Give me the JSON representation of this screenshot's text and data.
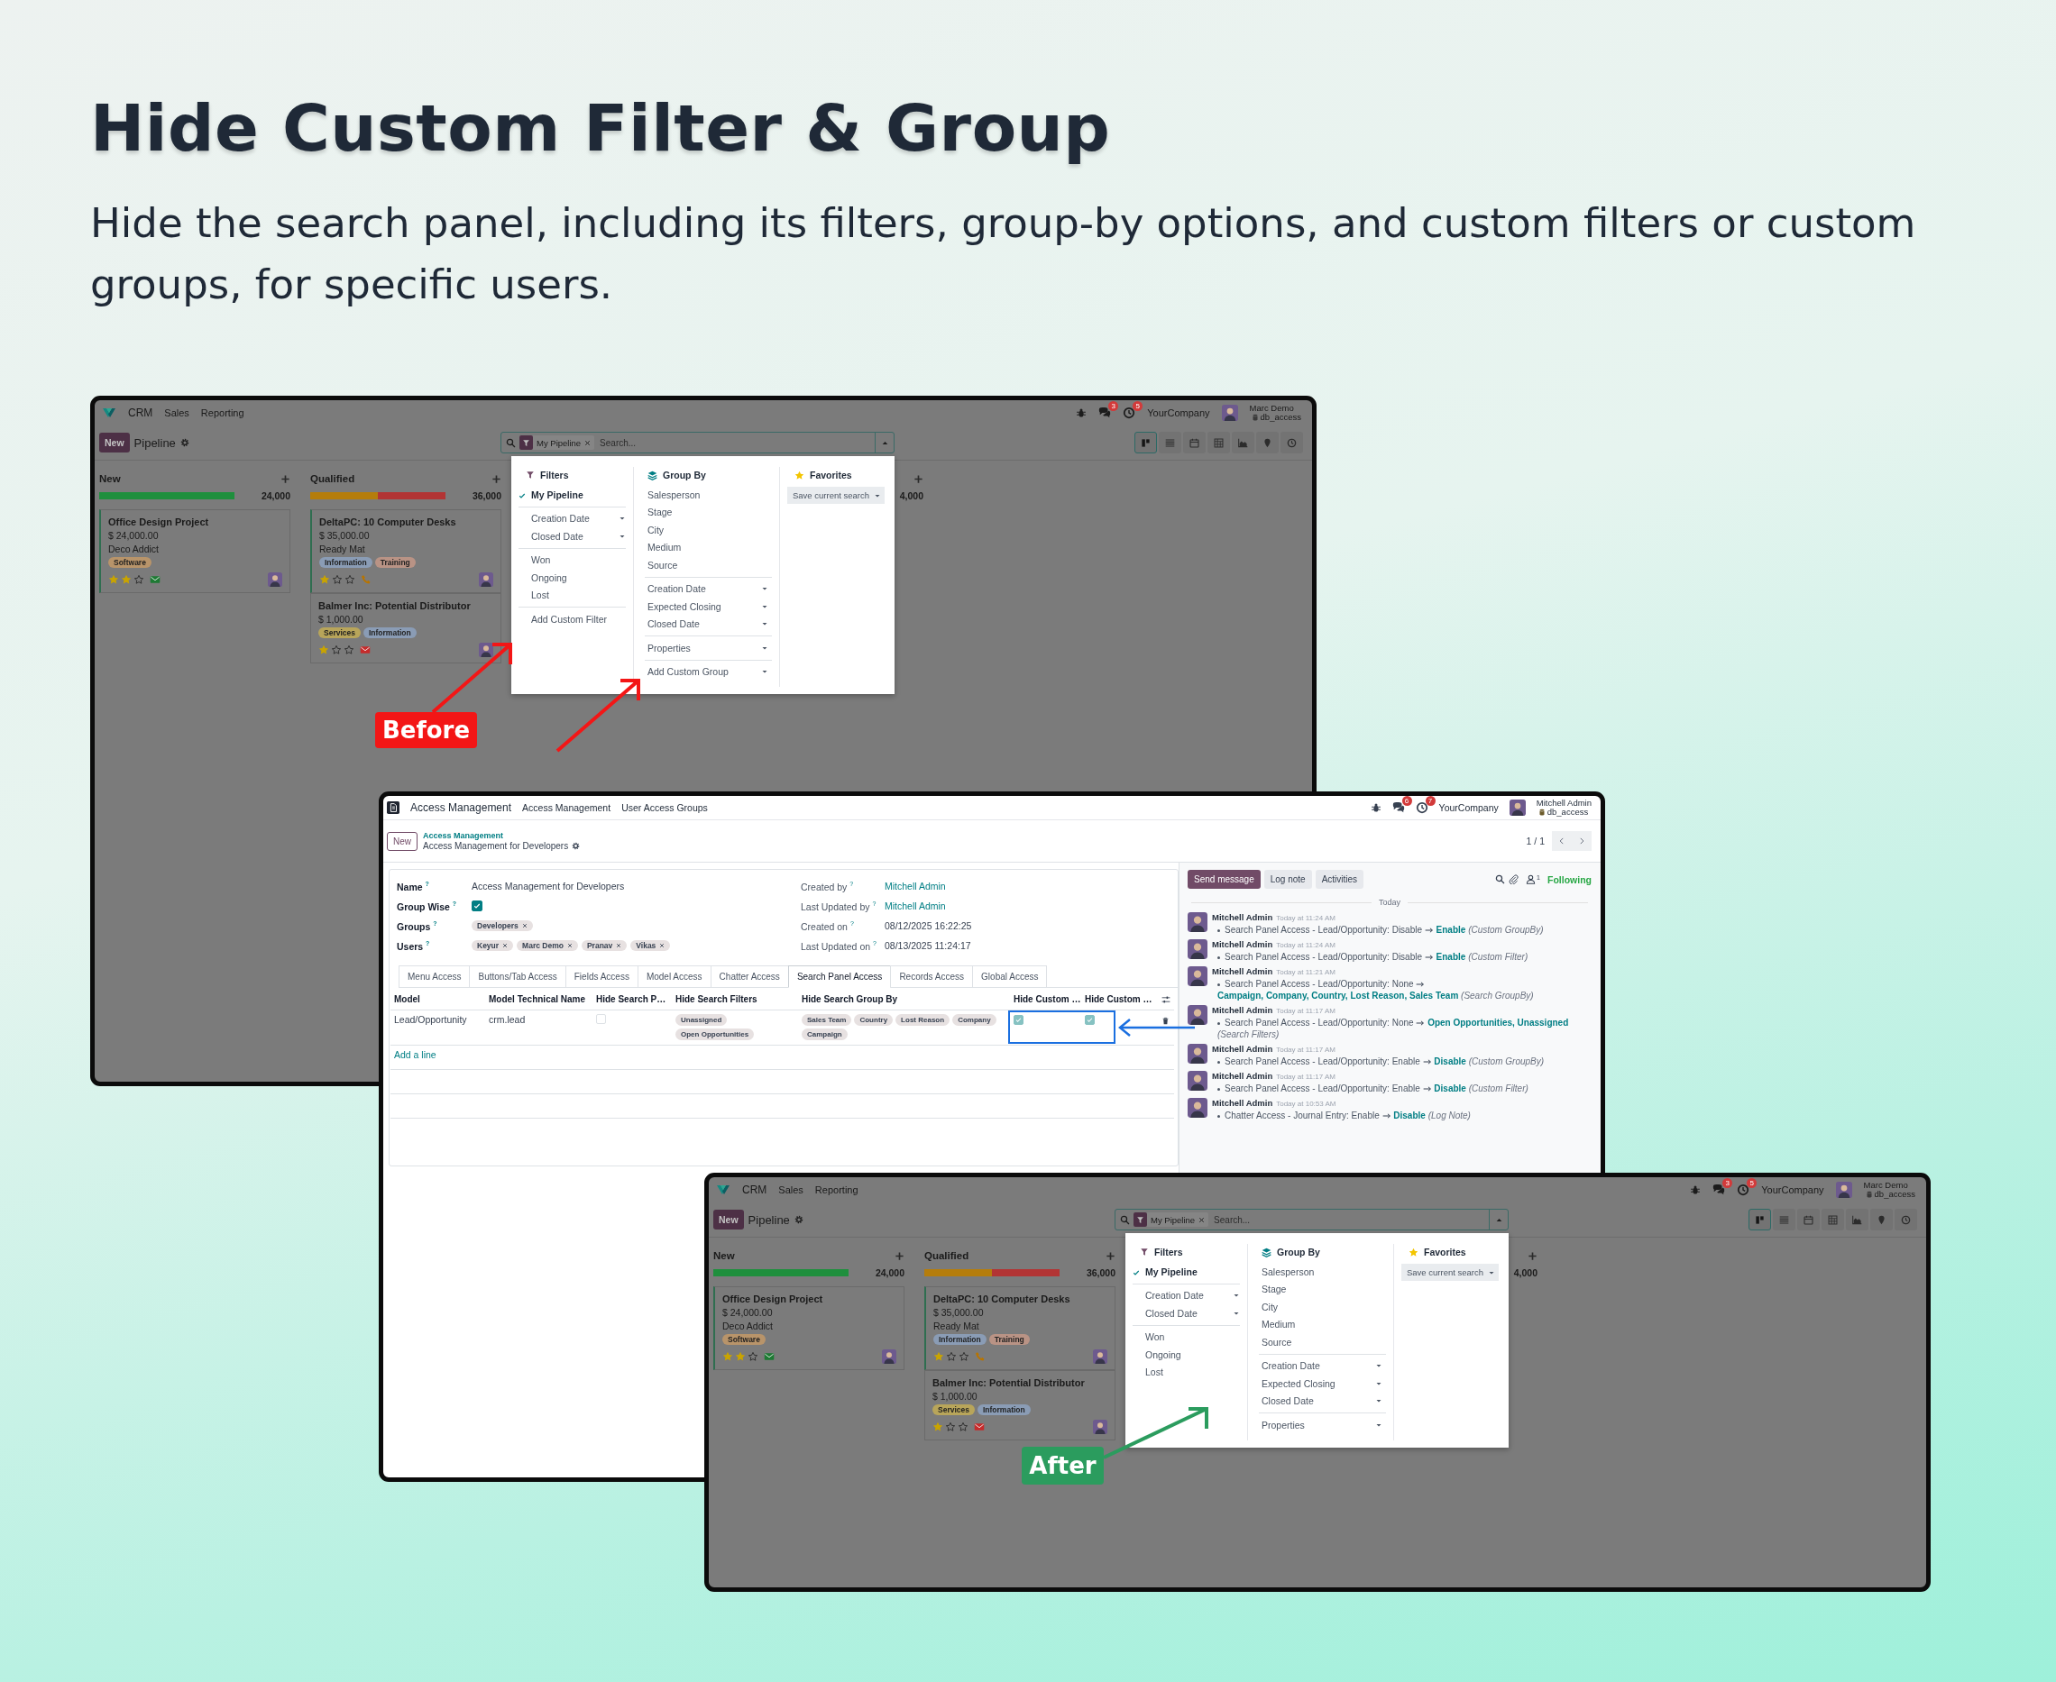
{
  "heading": {
    "title": "Hide Custom Filter & Group",
    "subtitle": "Hide the search panel, including its filters, group-by options, and custom filters or custom groups, for specific users."
  },
  "before_screen": {
    "app": "CRM",
    "menu": [
      "Sales",
      "Reporting"
    ],
    "systray": {
      "badges": [
        "3",
        "5"
      ],
      "company": "YourCompany",
      "user": "Marc Demo",
      "database": "db_access"
    },
    "new_button": "New",
    "title": "Pipeline",
    "search": {
      "facet": "My Pipeline",
      "placeholder": "Search..."
    },
    "views": [
      {
        "kind": "kanban",
        "selected": true
      },
      {
        "kind": "list",
        "selected": false
      },
      {
        "kind": "calendar",
        "selected": false
      },
      {
        "kind": "pivot",
        "selected": false
      },
      {
        "kind": "graph",
        "selected": false
      },
      {
        "kind": "map",
        "selected": false
      },
      {
        "kind": "activity",
        "selected": false
      }
    ],
    "columns": [
      {
        "title": "New",
        "total": "24,000",
        "progress": [
          {
            "color": "#1f8f3d",
            "level": 1
          }
        ],
        "cards": [
          {
            "title": "Office Design Project",
            "amount": "$ 24,000.00",
            "customer": "Deco Addict",
            "tags": [
              {
                "label": "Software",
                "color": "#b8946a"
              }
            ],
            "stars": 2,
            "activity": {
              "kind": "email",
              "color": "#1d7a33"
            }
          }
        ]
      },
      {
        "title": "Qualified",
        "total": "36,000",
        "progress": [
          {
            "color": "#b57d0c",
            "level": 0.5
          },
          {
            "color": "#b23434",
            "level": 0.5
          }
        ],
        "cards": [
          {
            "title": "DeltaPC: 10 Computer Desks",
            "amount": "$ 35,000.00",
            "customer": "Ready Mat",
            "tags": [
              {
                "label": "Information",
                "color": "#8a9cb5"
              },
              {
                "label": "Training",
                "color": "#b99385"
              }
            ],
            "stars": 1,
            "activity": {
              "kind": "phone",
              "color": "#b87400"
            }
          },
          {
            "title": "Balmer Inc: Potential Distributor",
            "amount": "$ 1,000.00",
            "tags": [
              {
                "label": "Services",
                "color": "#b8a55a"
              },
              {
                "label": "Information",
                "color": "#8a9cb5"
              }
            ],
            "stars": 1,
            "activity": {
              "kind": "email",
              "color": "#c62b2b"
            }
          }
        ]
      },
      {
        "total": "4,000"
      }
    ],
    "dropdown": {
      "filters": {
        "title": "Filters",
        "sections": [
          [
            {
              "label": "My Pipeline",
              "kind": "option",
              "checked": true
            }
          ],
          [
            {
              "label": "Creation Date",
              "kind": "submenu",
              "checked": false
            },
            {
              "label": "Closed Date",
              "kind": "submenu",
              "checked": false
            }
          ],
          [
            {
              "label": "Won",
              "kind": "option",
              "checked": false
            },
            {
              "label": "Ongoing",
              "kind": "option",
              "checked": false
            },
            {
              "label": "Lost",
              "kind": "option",
              "checked": false
            }
          ],
          [
            {
              "label": "Add Custom Filter",
              "kind": "action",
              "checked": false
            }
          ]
        ]
      },
      "group_by": {
        "title": "Group By",
        "sections": [
          [
            {
              "label": "Salesperson",
              "kind": "option"
            },
            {
              "label": "Stage",
              "kind": "option"
            },
            {
              "label": "City",
              "kind": "option"
            },
            {
              "label": "Medium",
              "kind": "option"
            },
            {
              "label": "Source",
              "kind": "option"
            }
          ],
          [
            {
              "label": "Creation Date",
              "kind": "submenu"
            },
            {
              "label": "Expected Closing",
              "kind": "submenu"
            },
            {
              "label": "Closed Date",
              "kind": "submenu"
            }
          ],
          [
            {
              "label": "Properties",
              "kind": "submenu"
            }
          ],
          [
            {
              "label": "Add Custom Group",
              "kind": "select"
            }
          ]
        ]
      },
      "favorites": {
        "title": "Favorites",
        "save_button": "Save current search"
      }
    }
  },
  "form_screen": {
    "app": "Access Management",
    "menu": [
      "Access Management",
      "User Access Groups"
    ],
    "systray": {
      "badges": [
        "6",
        "7"
      ],
      "company": "YourCompany",
      "user": "Mitchell Admin",
      "database": "db_access"
    },
    "new_button": "New",
    "breadcrumb": {
      "parent": "Access Management",
      "current": "Access Management for Developers"
    },
    "pager": "1 / 1",
    "fields_left": [
      {
        "label": "Name $^{?}$",
        "kind": "text",
        "value": "Access Management for Developers"
      },
      {
        "label": "Group Wise $^{?}$",
        "kind": "checkbox",
        "checked": true
      },
      {
        "label": "Groups $^{?}$",
        "kind": "tags",
        "tags": [
          "Developers"
        ]
      },
      {
        "label": "Users $^{?}$",
        "kind": "tags",
        "tags": [
          "Keyur",
          "Marc Demo",
          "Pranav",
          "Vikas"
        ]
      }
    ],
    "fields_right": [
      {
        "label": "Created by $^{?}$",
        "kind": "link",
        "value": "Mitchell Admin"
      },
      {
        "label": "Last Updated by $^{?}$",
        "kind": "link",
        "value": "Mitchell Admin"
      },
      {
        "label": "Created on $^{?}$",
        "kind": "text",
        "value": "08/12/2025 16:22:25"
      },
      {
        "label": "Last Updated on $^{?}$",
        "kind": "text",
        "value": "08/13/2025 11:24:17"
      }
    ],
    "tabs": [
      {
        "label": "Menu Access",
        "selected": false
      },
      {
        "label": "Buttons/Tab Access",
        "selected": false
      },
      {
        "label": "Fields Access",
        "selected": false
      },
      {
        "label": "Model Access",
        "selected": false
      },
      {
        "label": "Chatter Access",
        "selected": false
      },
      {
        "label": "Search Panel Access",
        "selected": true
      },
      {
        "label": "Records Access",
        "selected": false
      },
      {
        "label": "Global Access",
        "selected": false
      }
    ],
    "table": {
      "columns": [
        "Model",
        "Model Technical Name",
        "Hide Search P…",
        "Hide Search Filters",
        "Hide Search Group By",
        "Hide Custom …",
        "Hide Custom …"
      ],
      "rows": [
        {
          "cells": [
            {
              "kind": "text",
              "text": "Lead/Opportunity"
            },
            {
              "kind": "text",
              "text": "crm.lead"
            },
            {
              "kind": "checkbox",
              "checked": false
            },
            {
              "kind": "tags",
              "tags": [
                "Unassigned",
                "Open Opportunities"
              ]
            },
            {
              "kind": "tags",
              "tags": [
                "Sales Team",
                "Country",
                "Lost Reason",
                "Company",
                "Campaign"
              ]
            },
            {
              "kind": "checkbox",
              "checked": true
            },
            {
              "kind": "checkbox",
              "checked": true
            }
          ]
        }
      ],
      "add_line": "Add a line"
    },
    "chatter": {
      "buttons": [
        {
          "label": "Send message",
          "selected": true
        },
        {
          "label": "Log note",
          "selected": false
        },
        {
          "label": "Activities",
          "selected": false
        }
      ],
      "followers": "1",
      "following": "Following",
      "date_separator": "Today",
      "messages": [
        {
          "author": "Mitchell Admin",
          "time": "Today at 11:24 AM",
          "change": "Search Panel Access - Lead/Opportunity: Disable",
          "new_value": "Enable",
          "field": "(Custom GroupBy)"
        },
        {
          "author": "Mitchell Admin",
          "time": "Today at 11:24 AM",
          "change": "Search Panel Access - Lead/Opportunity: Disable",
          "new_value": "Enable",
          "field": "(Custom Filter)"
        },
        {
          "author": "Mitchell Admin",
          "time": "Today at 11:21 AM",
          "change": "Search Panel Access - Lead/Opportunity: None",
          "new_value": "Campaign, Company, Country, Lost Reason, Sales Team",
          "field": "(Search GroupBy)"
        },
        {
          "author": "Mitchell Admin",
          "time": "Today at 11:17 AM",
          "change": "Search Panel Access - Lead/Opportunity: None",
          "new_value": "Open Opportunities, Unassigned",
          "field": "(Search Filters)"
        },
        {
          "author": "Mitchell Admin",
          "time": "Today at 11:17 AM",
          "change": "Search Panel Access - Lead/Opportunity: Enable",
          "new_value": "Disable",
          "field": "(Custom GroupBy)"
        },
        {
          "author": "Mitchell Admin",
          "time": "Today at 11:17 AM",
          "change": "Search Panel Access - Lead/Opportunity: Enable",
          "new_value": "Disable",
          "field": "(Custom Filter)"
        },
        {
          "author": "Mitchell Admin",
          "time": "Today at 10:53 AM",
          "change": "Chatter Access - Journal Entry: Enable",
          "new_value": "Disable",
          "field": "(Log Note)"
        }
      ]
    }
  },
  "after_screen": {
    "app": "CRM",
    "menu": [
      "Sales",
      "Reporting"
    ],
    "systray": {
      "badges": [
        "3",
        "5"
      ],
      "company": "YourCompany",
      "user": "Marc Demo",
      "database": "db_access"
    },
    "new_button": "New",
    "title": "Pipeline",
    "search": {
      "facet": "My Pipeline",
      "placeholder": "Search..."
    },
    "views": [
      {
        "kind": "kanban",
        "selected": true
      },
      {
        "kind": "list",
        "selected": false
      },
      {
        "kind": "calendar",
        "selected": false
      },
      {
        "kind": "pivot",
        "selected": false
      },
      {
        "kind": "graph",
        "selected": false
      },
      {
        "kind": "map",
        "selected": false
      },
      {
        "kind": "activity",
        "selected": false
      }
    ],
    "columns": [
      {
        "title": "New",
        "total": "24,000",
        "progress": [
          {
            "color": "#1f8f3d",
            "level": 1
          }
        ],
        "cards": [
          {
            "title": "Office Design Project",
            "amount": "$ 24,000.00",
            "customer": "Deco Addict",
            "tags": [
              {
                "label": "Software",
                "color": "#b8946a"
              }
            ],
            "stars": 2,
            "activity": {
              "kind": "email",
              "color": "#1d7a33"
            }
          }
        ]
      },
      {
        "title": "Qualified",
        "total": "36,000",
        "progress": [
          {
            "color": "#b57d0c",
            "level": 0.5
          },
          {
            "color": "#b23434",
            "level": 0.5
          }
        ],
        "cards": [
          {
            "title": "DeltaPC: 10 Computer Desks",
            "amount": "$ 35,000.00",
            "customer": "Ready Mat",
            "tags": [
              {
                "label": "Information",
                "color": "#8a9cb5"
              },
              {
                "label": "Training",
                "color": "#b99385"
              }
            ],
            "stars": 1,
            "activity": {
              "kind": "phone",
              "color": "#b87400"
            }
          },
          {
            "title": "Balmer Inc: Potential Distributor",
            "amount": "$ 1,000.00",
            "tags": [
              {
                "label": "Services",
                "color": "#b8a55a"
              },
              {
                "label": "Information",
                "color": "#8a9cb5"
              }
            ],
            "stars": 1,
            "activity": {
              "kind": "email",
              "color": "#c62b2b"
            }
          }
        ]
      },
      {
        "total": "4,000"
      }
    ],
    "dropdown": {
      "filters": {
        "title": "Filters",
        "sections": [
          [
            {
              "label": "My Pipeline",
              "kind": "option",
              "checked": true
            }
          ],
          [
            {
              "label": "Creation Date",
              "kind": "submenu",
              "checked": false
            },
            {
              "label": "Closed Date",
              "kind": "submenu",
              "checked": false
            }
          ],
          [
            {
              "label": "Won",
              "kind": "option",
              "checked": false
            },
            {
              "label": "Ongoing",
              "kind": "option",
              "checked": false
            },
            {
              "label": "Lost",
              "kind": "option",
              "checked": false
            }
          ]
        ]
      },
      "group_by": {
        "title": "Group By",
        "sections": [
          [
            {
              "label": "Salesperson",
              "kind": "option"
            },
            {
              "label": "Stage",
              "kind": "option"
            },
            {
              "label": "City",
              "kind": "option"
            },
            {
              "label": "Medium",
              "kind": "option"
            },
            {
              "label": "Source",
              "kind": "option"
            }
          ],
          [
            {
              "label": "Creation Date",
              "kind": "submenu"
            },
            {
              "label": "Expected Closing",
              "kind": "submenu"
            },
            {
              "label": "Closed Date",
              "kind": "submenu"
            }
          ],
          [
            {
              "label": "Properties",
              "kind": "submenu"
            }
          ]
        ]
      },
      "favorites": {
        "title": "Favorites",
        "save_button": "Save current search"
      }
    }
  },
  "callouts": [
    {
      "text": "Before",
      "color": "#f31616"
    },
    {
      "text": "After",
      "color": "#2b9c5e"
    }
  ]
}
